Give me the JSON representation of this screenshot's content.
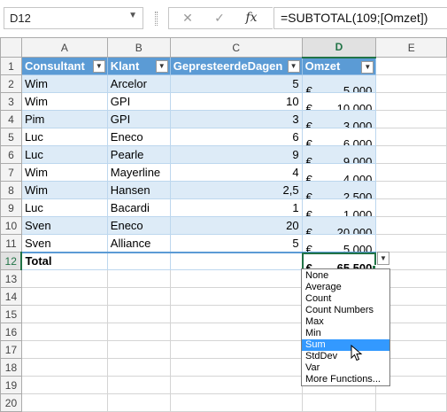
{
  "formula_bar": {
    "cell_ref": "D12",
    "namebox_arrow": "▼",
    "cancel_glyph": "✕",
    "confirm_glyph": "✓",
    "fx_glyph": "fx",
    "formula": "=SUBTOTAL(109;[Omzet])"
  },
  "columns": [
    "A",
    "B",
    "C",
    "D",
    "E"
  ],
  "rows": [
    "1",
    "2",
    "3",
    "4",
    "5",
    "6",
    "7",
    "8",
    "9",
    "10",
    "11",
    "12",
    "13",
    "14",
    "15",
    "16",
    "17",
    "18",
    "19",
    "20"
  ],
  "table": {
    "headers": [
      "Consultant",
      "Klant",
      "GepresteerdeDagen",
      "Omzet"
    ],
    "filter_glyph": "▼",
    "currency": "€",
    "data": [
      {
        "consultant": "Wim",
        "klant": "Arcelor",
        "dagen": "5",
        "omzet": "5.000"
      },
      {
        "consultant": "Wim",
        "klant": "GPI",
        "dagen": "10",
        "omzet": "10.000"
      },
      {
        "consultant": "Pim",
        "klant": "GPI",
        "dagen": "3",
        "omzet": "3.000"
      },
      {
        "consultant": "Luc",
        "klant": "Eneco",
        "dagen": "6",
        "omzet": "6.000"
      },
      {
        "consultant": "Luc",
        "klant": "Pearle",
        "dagen": "9",
        "omzet": "9.000"
      },
      {
        "consultant": "Wim",
        "klant": "Mayerline",
        "dagen": "4",
        "omzet": "4.000"
      },
      {
        "consultant": "Wim",
        "klant": "Hansen",
        "dagen": "2,5",
        "omzet": "2.500"
      },
      {
        "consultant": "Luc",
        "klant": "Bacardi",
        "dagen": "1",
        "omzet": "1.000"
      },
      {
        "consultant": "Sven",
        "klant": "Eneco",
        "dagen": "20",
        "omzet": "20.000"
      },
      {
        "consultant": "Sven",
        "klant": "Alliance",
        "dagen": "5",
        "omzet": "5.000"
      }
    ],
    "total_label": "Total",
    "total_value": "65.500"
  },
  "total_dropdown": {
    "glyph": "▼",
    "options": [
      "None",
      "Average",
      "Count",
      "Count Numbers",
      "Max",
      "Min",
      "Sum",
      "StdDev",
      "Var",
      "More Functions..."
    ],
    "highlighted": "Sum"
  },
  "colors": {
    "header_fill": "#5b9bd5",
    "band_fill": "#ddebf7",
    "selection": "#217346",
    "dropdown_highlight": "#3399ff"
  }
}
